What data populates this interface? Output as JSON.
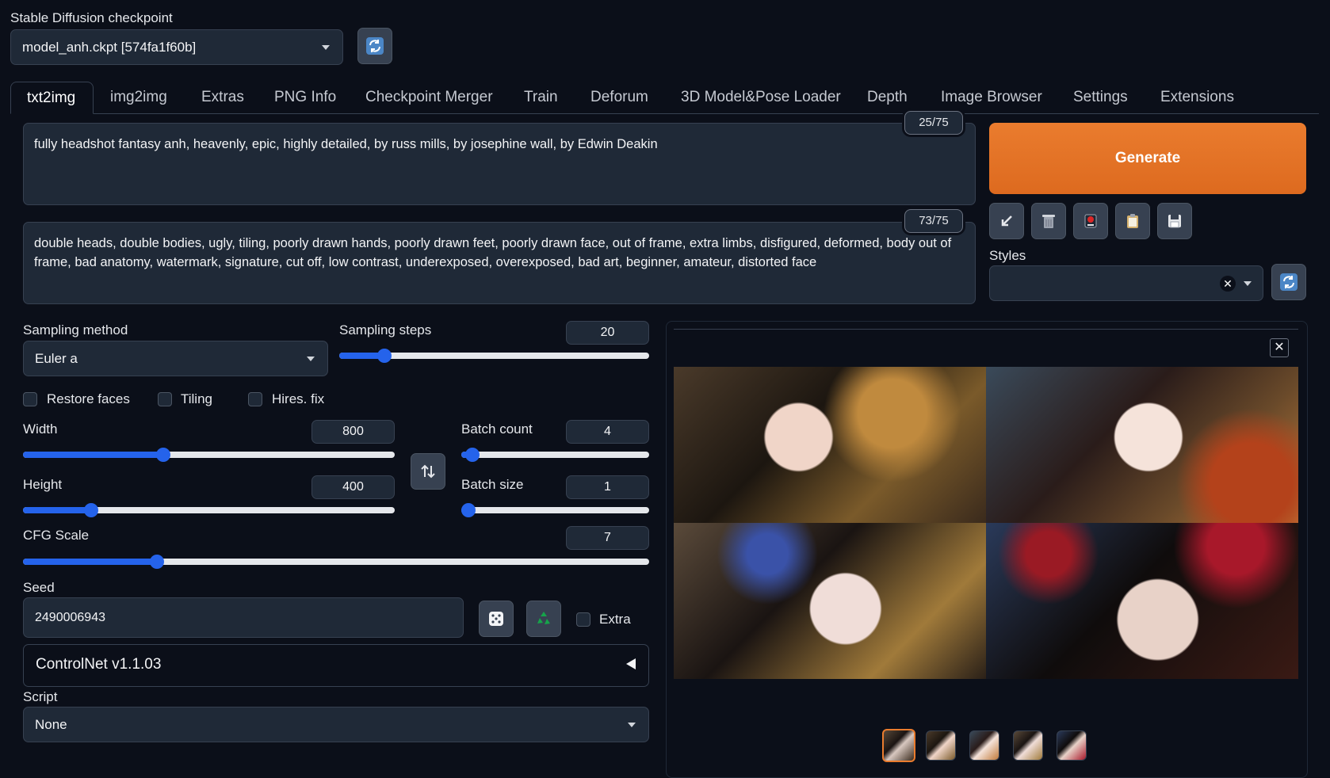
{
  "checkpoint": {
    "label": "Stable Diffusion checkpoint",
    "value": "model_anh.ckpt [574fa1f60b]"
  },
  "tabs": [
    {
      "label": "txt2img",
      "active": true
    },
    {
      "label": "img2img"
    },
    {
      "label": "Extras"
    },
    {
      "label": "PNG Info"
    },
    {
      "label": "Checkpoint Merger"
    },
    {
      "label": "Train"
    },
    {
      "label": "Deforum"
    },
    {
      "label": "3D Model&Pose Loader"
    },
    {
      "label": "Depth"
    },
    {
      "label": "Image Browser"
    },
    {
      "label": "Settings"
    },
    {
      "label": "Extensions"
    }
  ],
  "prompt": {
    "text": "fully headshot fantasy anh, heavenly, epic, highly detailed, by russ mills, by josephine wall, by Edwin Deakin",
    "counter": "25/75"
  },
  "negative_prompt": {
    "text": "double heads, double bodies, ugly, tiling, poorly drawn hands, poorly drawn feet, poorly drawn face, out of frame, extra limbs, disfigured, deformed, body out of frame, bad anatomy, watermark, signature, cut off, low contrast, underexposed, overexposed, bad art, beginner, amateur, distorted face",
    "counter": "73/75"
  },
  "generate": {
    "label": "Generate"
  },
  "styles": {
    "label": "Styles",
    "value": ""
  },
  "sampling": {
    "method_label": "Sampling method",
    "method_value": "Euler a",
    "steps_label": "Sampling steps",
    "steps_value": "20"
  },
  "checkboxes": {
    "restore_faces": "Restore faces",
    "tiling": "Tiling",
    "hires_fix": "Hires. fix"
  },
  "width": {
    "label": "Width",
    "value": "800"
  },
  "height": {
    "label": "Height",
    "value": "400"
  },
  "batch_count": {
    "label": "Batch count",
    "value": "4"
  },
  "batch_size": {
    "label": "Batch size",
    "value": "1"
  },
  "cfg": {
    "label": "CFG Scale",
    "value": "7"
  },
  "seed": {
    "label": "Seed",
    "value": "2490006943",
    "extra_label": "Extra"
  },
  "controlnet": {
    "label": "ControlNet v1.1.03"
  },
  "script": {
    "label": "Script",
    "value": "None"
  },
  "colors": {
    "background": "#0b0f19",
    "panel": "#1f2937",
    "accent": "#2563eb",
    "generate": "#e46f24"
  },
  "icons": {
    "refresh": "refresh-icon",
    "arrow": "arrow-down-left-icon",
    "trash": "trash-icon",
    "extra_networks": "extra-networks-icon",
    "clipboard": "clipboard-icon",
    "save": "save-icon",
    "swap": "swap-icon",
    "dice": "dice-icon",
    "recycle": "recycle-icon",
    "close": "close-icon"
  }
}
